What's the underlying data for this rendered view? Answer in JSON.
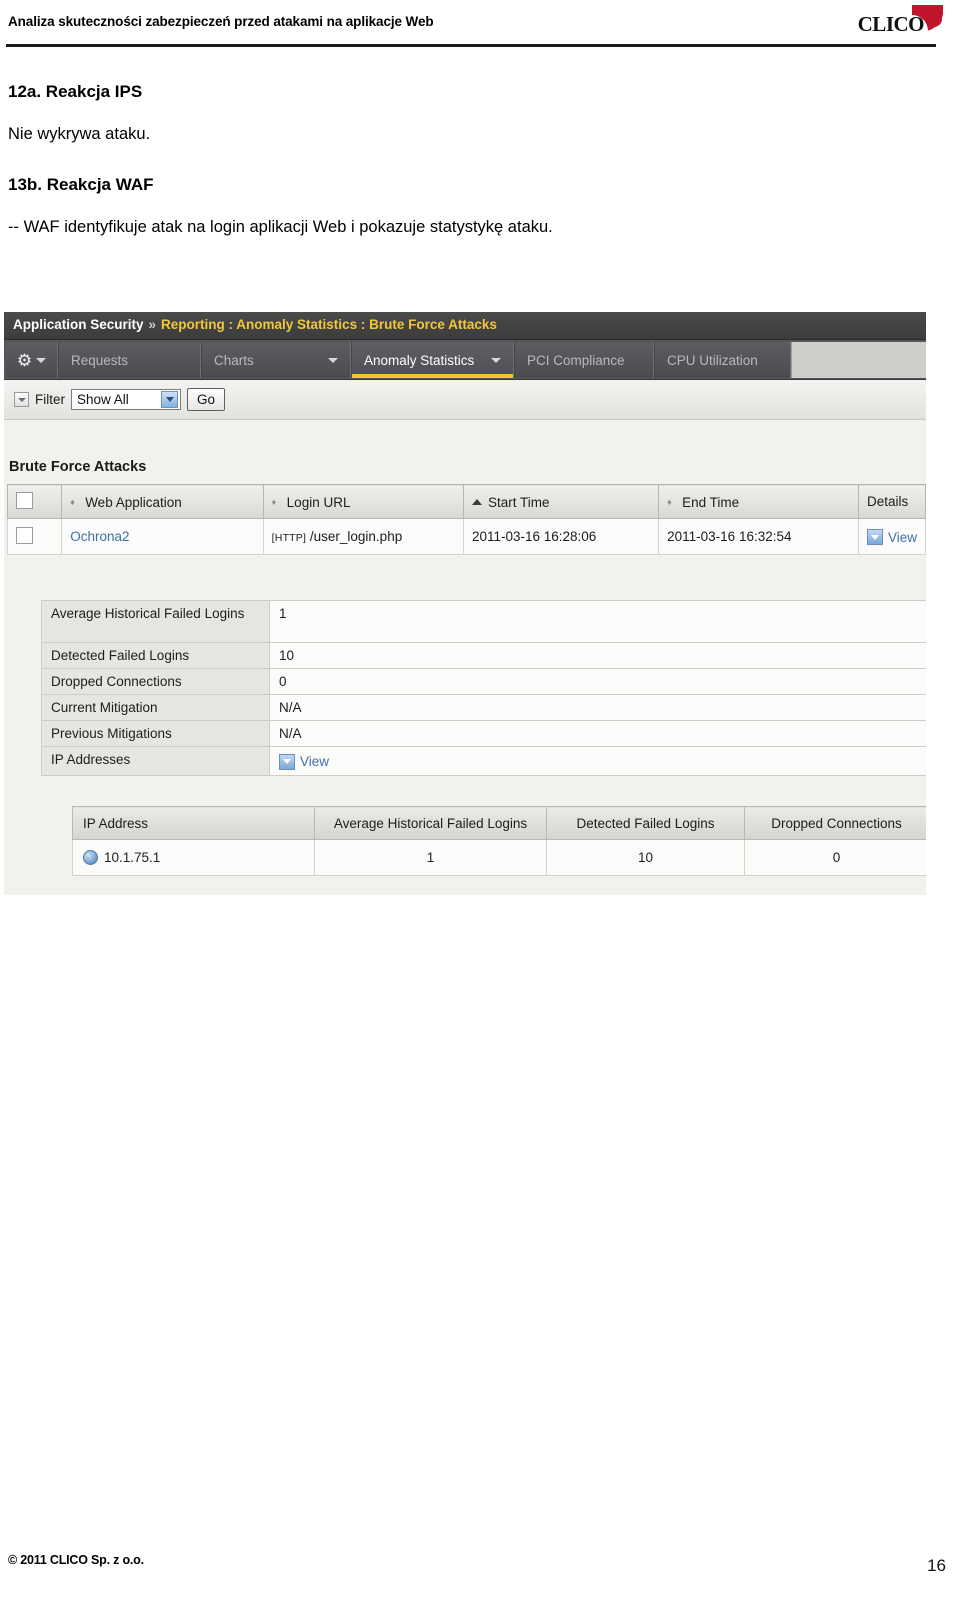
{
  "page": {
    "header_title": "Analiza skuteczności zabezpieczeń przed atakami na aplikacje Web",
    "logo_text": "CLICO",
    "logo_icon": "clico-quarter-circle-mark",
    "footer_copyright": "© 2011 CLICO Sp. z o.o.",
    "page_number": "16"
  },
  "document": {
    "heading_12a": "12a. Reakcja IPS",
    "paragraph_12a": "Nie wykrywa ataku.",
    "heading_13b": "13b. Reakcja WAF",
    "paragraph_13b": "-- WAF identyfikuje atak na login aplikacji Web i pokazuje statystykę ataku."
  },
  "screenshot": {
    "breadcrumb": {
      "root": "Application Security",
      "separator": "»",
      "path": "Reporting : Anomaly Statistics : Brute Force Attacks"
    },
    "tabs": {
      "gear_icon": "gear-icon",
      "items": [
        {
          "label": "Requests",
          "has_dropdown": false,
          "active": false
        },
        {
          "label": "Charts",
          "has_dropdown": true,
          "active": false
        },
        {
          "label": "Anomaly Statistics",
          "has_dropdown": true,
          "active": true
        },
        {
          "label": "PCI Compliance",
          "has_dropdown": false,
          "active": false
        },
        {
          "label": "CPU Utilization",
          "has_dropdown": false,
          "active": false
        }
      ]
    },
    "filter": {
      "label": "Filter",
      "selected": "Show All",
      "go_label": "Go"
    },
    "section_title": "Brute Force Attacks",
    "attacks_table": {
      "columns": [
        "Web Application",
        "Login URL",
        "Start Time",
        "End Time",
        "Details"
      ],
      "sort_column": "Start Time",
      "sort_direction": "asc",
      "rows": [
        {
          "web_application": "Ochrona2",
          "login_protocol": "[HTTP]",
          "login_url": "/user_login.php",
          "start_time": "2011-03-16 16:28:06",
          "end_time": "2011-03-16 16:32:54",
          "details_label": "View"
        }
      ]
    },
    "detail_table": {
      "rows": [
        {
          "key": "Average Historical Failed Logins",
          "value": "1"
        },
        {
          "key": "Detected Failed Logins",
          "value": "10"
        },
        {
          "key": "Dropped Connections",
          "value": "0"
        },
        {
          "key": "Current Mitigation",
          "value": "N/A"
        },
        {
          "key": "Previous Mitigations",
          "value": "N/A"
        },
        {
          "key": "IP Addresses",
          "value": "View"
        }
      ]
    },
    "ip_table": {
      "columns": [
        "IP Address",
        "Average Historical Failed Logins",
        "Detected Failed Logins",
        "Dropped Connections"
      ],
      "rows": [
        {
          "ip_address": "10.1.75.1",
          "avg_historical_failed_logins": "1",
          "detected_failed_logins": "10",
          "dropped_connections": "0"
        }
      ]
    },
    "colors": {
      "breadcrumb_bg": "#3c3c3c",
      "breadcrumb_path": "#f0c838",
      "tab_active_underline": "#f2c230",
      "link": "#3f6fa8"
    }
  }
}
